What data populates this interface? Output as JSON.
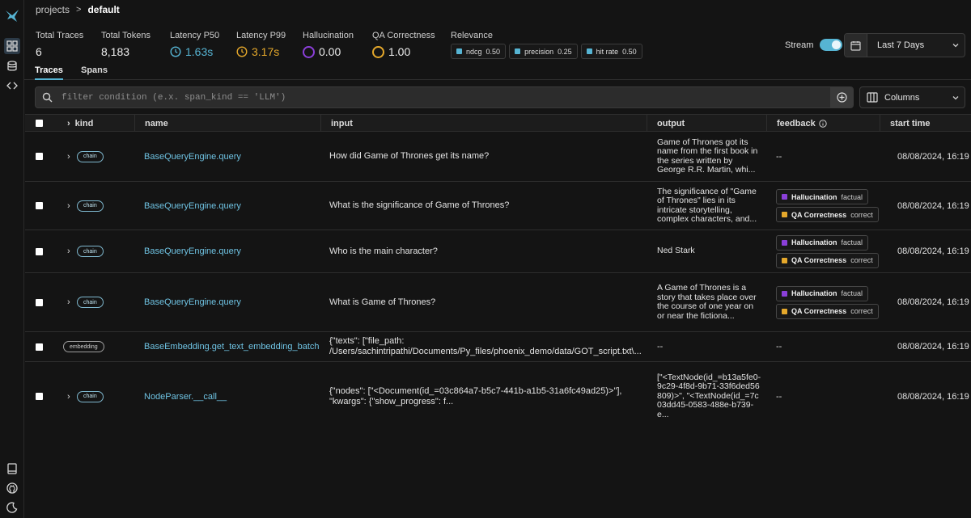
{
  "breadcrumb": {
    "root": "projects",
    "separator": ">",
    "current": "default"
  },
  "stats": {
    "total_traces": {
      "label": "Total Traces",
      "value": "6"
    },
    "total_tokens": {
      "label": "Total Tokens",
      "value": "8,183"
    },
    "latency_p50": {
      "label": "Latency P50",
      "value": "1.63s",
      "color": "#56b4d3"
    },
    "latency_p99": {
      "label": "Latency P99",
      "value": "3.17s",
      "color": "#e5a82b"
    },
    "hallucination": {
      "label": "Hallucination",
      "value": "0.00",
      "color": "#8b3fd9"
    },
    "qa_correctness": {
      "label": "QA Correctness",
      "value": "1.00",
      "color": "#e5a82b"
    },
    "relevance": {
      "label": "Relevance",
      "items": [
        {
          "name": "ndcg",
          "value": "0.50"
        },
        {
          "name": "precision",
          "value": "0.25"
        },
        {
          "name": "hit rate",
          "value": "0.50"
        }
      ]
    }
  },
  "stream": {
    "label": "Stream",
    "on": true
  },
  "time_range": {
    "value": "Last 7 Days"
  },
  "tabs": [
    {
      "label": "Traces",
      "active": true
    },
    {
      "label": "Spans",
      "active": false
    }
  ],
  "filter": {
    "placeholder": "filter condition (e.x. span_kind == 'LLM')",
    "value": ""
  },
  "columns_button": {
    "label": "Columns"
  },
  "table": {
    "headers": {
      "kind": "kind",
      "name": "name",
      "input": "input",
      "output": "output",
      "feedback": "feedback",
      "start_time": "start time"
    },
    "rows": [
      {
        "kind": "chain",
        "name": "BaseQueryEngine.query",
        "input": "How did Game of Thrones get its name?",
        "output": "Game of Thrones got its name from the first book in the series written by George R.R. Martin, whi...",
        "feedback": "--",
        "start_time": "08/08/2024, 16:19"
      },
      {
        "kind": "chain",
        "name": "BaseQueryEngine.query",
        "input": "What is the significance of Game of Thrones?",
        "output": "The significance of \"Game of Thrones\" lies in its intricate storytelling, complex characters, and...",
        "annotations": [
          {
            "name": "Hallucination",
            "value": "factual",
            "color": "#8b3fd9"
          },
          {
            "name": "QA Correctness",
            "value": "correct",
            "color": "#e5a82b"
          }
        ],
        "start_time": "08/08/2024, 16:19"
      },
      {
        "kind": "chain",
        "name": "BaseQueryEngine.query",
        "input": "Who is the main character?",
        "output": "Ned Stark",
        "annotations": [
          {
            "name": "Hallucination",
            "value": "factual",
            "color": "#8b3fd9"
          },
          {
            "name": "QA Correctness",
            "value": "correct",
            "color": "#e5a82b"
          }
        ],
        "start_time": "08/08/2024, 16:19"
      },
      {
        "kind": "chain",
        "name": "BaseQueryEngine.query",
        "input": "What is Game of Thrones?",
        "output": "A Game of Thrones is a story that takes place over the course of one year on or near the fictiona...",
        "annotations": [
          {
            "name": "Hallucination",
            "value": "factual",
            "color": "#8b3fd9"
          },
          {
            "name": "QA Correctness",
            "value": "correct",
            "color": "#e5a82b"
          }
        ],
        "start_time": "08/08/2024, 16:19"
      },
      {
        "kind": "embedding",
        "name": "BaseEmbedding.get_text_embedding_batch",
        "input_line1": "{\"texts\": [\"file_path:",
        "input_line2": "/Users/sachintripathi/Documents/Py_files/phoenix_demo/data/GOT_script.txt\\...",
        "output": "--",
        "feedback": "--",
        "start_time": "08/08/2024, 16:19"
      },
      {
        "kind": "chain",
        "name": "NodeParser.__call__",
        "input_line1": "{\"nodes\": [\"<Document(id_=03c864a7-b5c7-441b-a1b5-31a6fc49ad25)>\"],",
        "input_line2": "\"kwargs\": {\"show_progress\": f...",
        "output": "[\"<TextNode(id_=b13a5fe0-9c29-4f8d-9b71-33f6ded56809)>\", \"<TextNode(id_=7c03dd45-0583-488e-b739-e...",
        "feedback": "--",
        "start_time": "08/08/2024, 16:19"
      }
    ]
  }
}
